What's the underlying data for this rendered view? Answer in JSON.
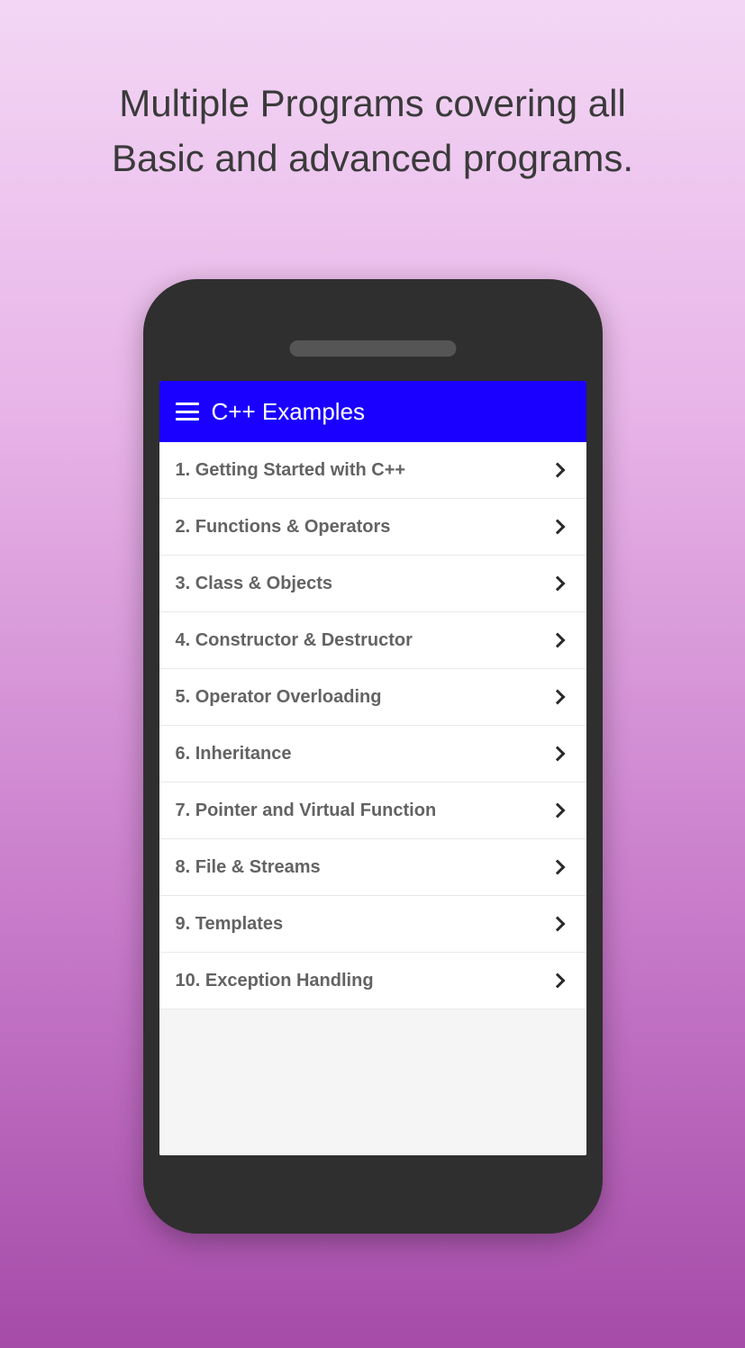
{
  "headline": {
    "line1": "Multiple Programs covering all",
    "line2": "Basic and advanced programs."
  },
  "app": {
    "title": "C++ Examples"
  },
  "list": {
    "items": [
      {
        "label": "1. Getting Started with C++"
      },
      {
        "label": "2. Functions & Operators"
      },
      {
        "label": "3. Class & Objects"
      },
      {
        "label": "4. Constructor & Destructor"
      },
      {
        "label": "5. Operator Overloading"
      },
      {
        "label": "6. Inheritance"
      },
      {
        "label": "7. Pointer and Virtual Function"
      },
      {
        "label": "8. File & Streams"
      },
      {
        "label": "9. Templates"
      },
      {
        "label": "10. Exception Handling"
      }
    ]
  }
}
